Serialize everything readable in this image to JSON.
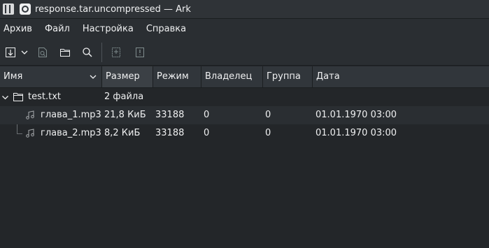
{
  "window": {
    "title": "response.tar.uncompressed — Ark"
  },
  "menubar": [
    "Архив",
    "Файл",
    "Настройка",
    "Справка"
  ],
  "toolbar": {
    "buttons": [
      "extract-icon",
      "dropdown-chevron-icon",
      "preview-icon",
      "open-folder-icon",
      "search-icon",
      "add-files-icon",
      "delete-files-icon"
    ]
  },
  "table": {
    "columns": [
      "Имя",
      "Размер",
      "Режим",
      "Владелец",
      "Группа",
      "Дата"
    ],
    "rows": [
      {
        "name": "test.txt",
        "size": "2 файла",
        "mode": "",
        "owner": "",
        "group": "",
        "date": "",
        "type": "folder"
      },
      {
        "name": "глава_1.mp3",
        "size": "21,8 КиБ",
        "mode": "33188",
        "owner": "0",
        "group": "0",
        "date": "01.01.1970 03:00",
        "type": "audio"
      },
      {
        "name": "глава_2.mp3",
        "size": "8,2 КиБ",
        "mode": "33188",
        "owner": "0",
        "group": "0",
        "date": "01.01.1970 03:00",
        "type": "audio"
      }
    ]
  },
  "colors": {
    "background": "#232629",
    "header": "#31363b",
    "row_alt": "#2a2e32"
  }
}
